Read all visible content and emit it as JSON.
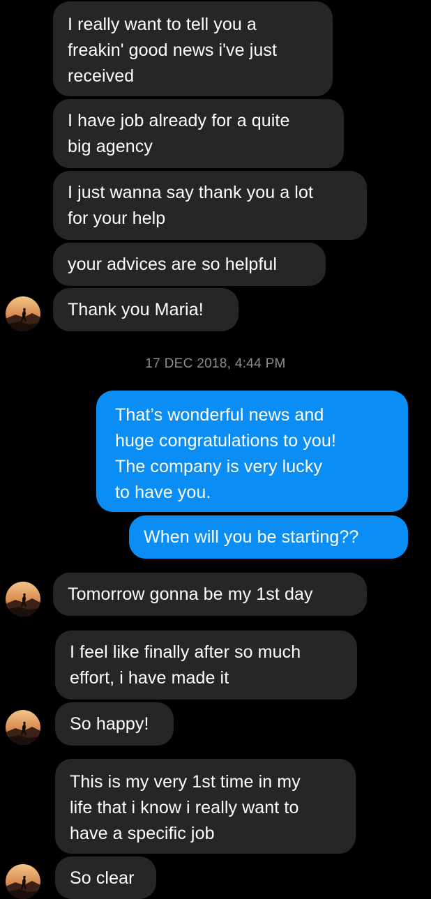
{
  "colors": {
    "background": "#000000",
    "incoming_bubble": "#262628",
    "outgoing_bubble": "#0a8ef6",
    "timestamp": "#8d8d92"
  },
  "avatar_icon": "contact-avatar-icon",
  "messages": [
    {
      "direction": "in",
      "text": "I really want to tell you a\nfreakin' good news i've just\nreceived"
    },
    {
      "direction": "in",
      "text": "I have job already for a quite\nbig agency"
    },
    {
      "direction": "in",
      "text": "I just wanna say thank you a lot\nfor your help"
    },
    {
      "direction": "in",
      "text": "your advices are so helpful"
    },
    {
      "direction": "in",
      "text": "Thank you Maria!"
    },
    {
      "direction": "out",
      "text": "That’s wonderful news and\nhuge congratulations to you!\nThe company is very lucky\nto have you."
    },
    {
      "direction": "out",
      "text": "When will you be starting??"
    },
    {
      "direction": "in",
      "text": "Tomorrow gonna be my 1st day"
    },
    {
      "direction": "in",
      "text": "I feel like finally after so much\neffort, i have made it"
    },
    {
      "direction": "in",
      "text": "So happy!"
    },
    {
      "direction": "in",
      "text": "This is my very 1st time in my\nlife that i know i really want to\nhave a specific job"
    },
    {
      "direction": "in",
      "text": "So clear"
    }
  ],
  "timestamp": "17 DEC 2018, 4:44 PM"
}
